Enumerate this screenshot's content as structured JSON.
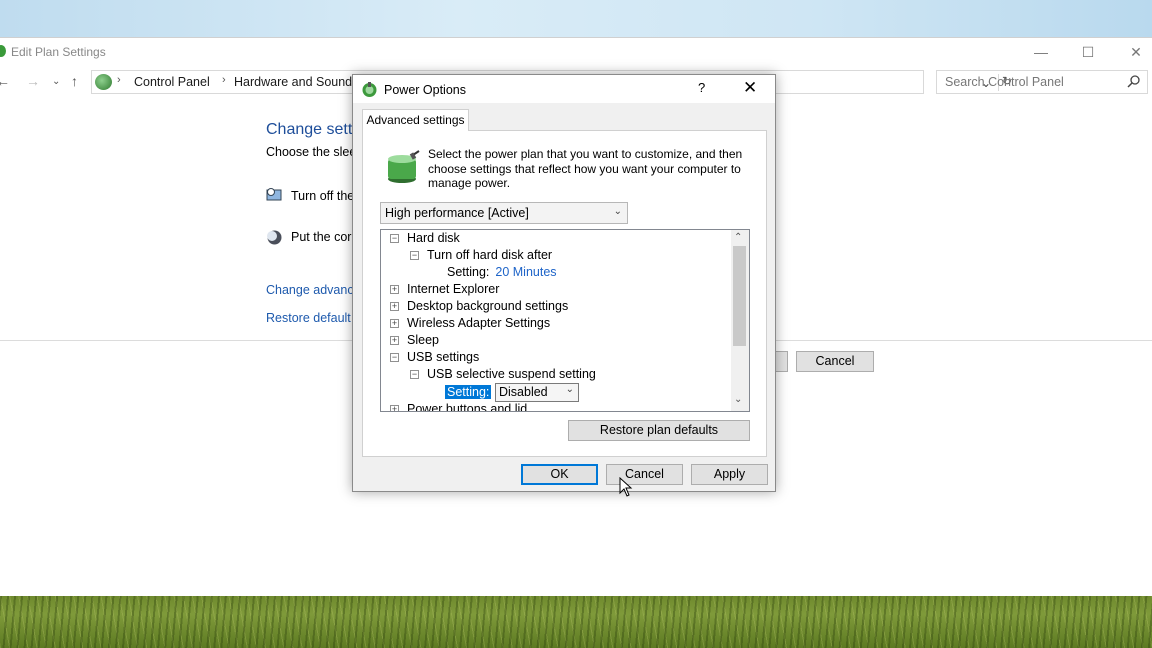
{
  "window": {
    "title": "Edit Plan Settings",
    "caption": {
      "minimize": "—",
      "maximize": "☐",
      "close": "✕"
    }
  },
  "addressbar": {
    "crumbs": [
      "Control Panel",
      "Hardware and Sound"
    ],
    "search_placeholder": "Search Control Panel"
  },
  "back_page": {
    "heading": "Change sett",
    "subtitle": "Choose the slee",
    "options": [
      "Turn off the",
      "Put the cor"
    ],
    "links": [
      "Change advanc",
      "Restore default"
    ],
    "cancel_label": "Cancel"
  },
  "dialog": {
    "title": "Power Options",
    "help": "?",
    "close": "✕",
    "tab_label": "Advanced settings",
    "intro": "Select the power plan that you want to customize, and then choose settings that reflect how you want your computer to manage power.",
    "plan_selected": "High performance [Active]",
    "tree": {
      "hard_disk": "Hard disk",
      "turn_off_hd": "Turn off hard disk after",
      "setting_label": "Setting:",
      "hd_setting_value": "20 Minutes",
      "internet_explorer": "Internet Explorer",
      "desktop_bg": "Desktop background settings",
      "wireless": "Wireless Adapter Settings",
      "sleep": "Sleep",
      "usb": "USB settings",
      "usb_suspend": "USB selective suspend setting",
      "usb_setting_label": "Setting:",
      "usb_setting_value": "Disabled",
      "power_buttons": "Power buttons and lid"
    },
    "restore_label": "Restore plan defaults",
    "ok_label": "OK",
    "cancel_label": "Cancel",
    "apply_label": "Apply"
  }
}
